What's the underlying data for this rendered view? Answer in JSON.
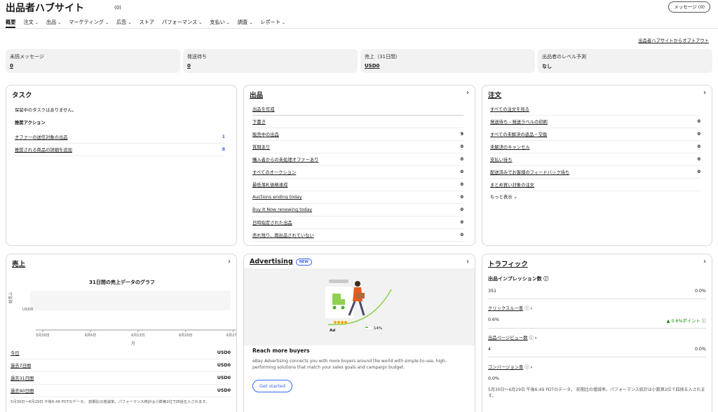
{
  "header": {
    "title": "出品者ハブサイト",
    "count": "(0)",
    "message_button": "メッセージ (0)"
  },
  "nav": {
    "items": [
      {
        "label": "概要",
        "has_menu": false
      },
      {
        "label": "注文",
        "has_menu": true
      },
      {
        "label": "出品",
        "has_menu": true
      },
      {
        "label": "マーケティング",
        "has_menu": true
      },
      {
        "label": "広告",
        "has_menu": true
      },
      {
        "label": "ストア",
        "has_menu": false
      },
      {
        "label": "パフォーマンス",
        "has_menu": true
      },
      {
        "label": "支払い",
        "has_menu": true
      },
      {
        "label": "調査",
        "has_menu": true
      },
      {
        "label": "レポート",
        "has_menu": true
      }
    ],
    "chevron": "⌄"
  },
  "optout": "出品者ハブサイトからオプトアウト",
  "stats": [
    {
      "label": "未読メッセージ",
      "value": "0",
      "link": true
    },
    {
      "label": "発送待ち",
      "value": "0",
      "link": true
    },
    {
      "label": "売上（31日間）",
      "value": "USD0",
      "link": true
    },
    {
      "label": "出品者のレベル予測",
      "value": "なし",
      "link": false
    }
  ],
  "tasks": {
    "title": "タスク",
    "empty": "保留中のタスクはありません。",
    "recommended": "推奨アクション",
    "rows": [
      {
        "label": "オファーの送信対象の出品",
        "value": "1"
      },
      {
        "label": "推奨される商品の詳細を追加",
        "value": "8"
      }
    ]
  },
  "listings": {
    "title": "出品",
    "arrow": "›",
    "top_link": "出品を作成",
    "rows": [
      {
        "label": "下書き",
        "value": ""
      },
      {
        "label": "販売中の出品",
        "value": "9"
      },
      {
        "label": "質問あり",
        "value": "0"
      },
      {
        "label": "購入者からの未処理オファーあり",
        "value": "0"
      },
      {
        "label": "すべてのオークション",
        "value": "0"
      },
      {
        "label": "最低落札価格達成",
        "value": "0"
      },
      {
        "label": "Auctions ending today",
        "value": "0"
      },
      {
        "label": "Buy It Now renewing today",
        "value": "0"
      },
      {
        "label": "日時指定された出品",
        "value": "0"
      },
      {
        "label": "売れ残り、再出品されていない",
        "value": "0"
      }
    ]
  },
  "orders": {
    "title": "注文",
    "arrow": "›",
    "rows": [
      {
        "label": "すべての注文を見る",
        "value": ""
      },
      {
        "label": "発送待ち - 発送ラベルの印刷",
        "value": "0"
      },
      {
        "label": "すべての未解決の返品・交換",
        "value": "0"
      },
      {
        "label": "未解決のキャンセル",
        "value": "0"
      },
      {
        "label": "支払い待ち",
        "value": "0"
      },
      {
        "label": "配送済みでお客様のフィードバック待ち",
        "value": "0"
      },
      {
        "label": "まとめ買い対象の注文",
        "value": ""
      }
    ],
    "more": "もっと表示",
    "more_icon": "⌄"
  },
  "sales": {
    "title": "売上",
    "arrow": "›",
    "chart_title": "31日間の売上データのグラフ",
    "ylabel": "総売上",
    "xlabel": "月",
    "rows": [
      {
        "label": "今日",
        "value": "USD0"
      },
      {
        "label": "過去7日間",
        "value": "USD0"
      },
      {
        "label": "過去31日間",
        "value": "USD0"
      },
      {
        "label": "過去90日間",
        "value": "USD0"
      }
    ],
    "footnote": "5月30日〜6月29日 午後6:49 PDTのデータ。 前期比の増減率。パフォーマンス統計は小数第2位で四捨五入されます。"
  },
  "chart_data": {
    "type": "line",
    "title": "31日間の売上データのグラフ",
    "xlabel": "月",
    "ylabel": "総売上",
    "x": [
      "5月30日",
      "6月6日",
      "6月13日",
      "6月20日",
      "6月27日"
    ],
    "series": [
      {
        "values": [
          0,
          0,
          0,
          0,
          0
        ]
      }
    ],
    "y_tick_labels": [
      "USD0"
    ],
    "grid": false
  },
  "advertising": {
    "title": "Advertising",
    "badge": "NEW",
    "arrow": "›",
    "ad_label": "Ad",
    "percent": "14%",
    "heading": "Reach more buyers",
    "body": "eBay Advertising connects you with more buyers around the world with simple-to-use, high-performing solutions that match your sales goals and campaign budget.",
    "cta": "Get started"
  },
  "traffic": {
    "title": "トラフィック",
    "arrow": "›",
    "impressions_label": "出品インプレッション数",
    "impressions": "351",
    "impressions_change": "0.0%",
    "ctr_label": "クリックスルー率",
    "ctr": "0.6%",
    "ctr_change": "▲ 0.6%ポイント",
    "views_label": "出品ページビュー数",
    "views": "4",
    "views_change": "0.0%",
    "conversion_label": "コンバージョン率",
    "conversion": "0.0%",
    "info_icon": "ⓘ",
    "link_chevron": "›",
    "footnote": "5月30日〜6月29日 午後6:49 PDTのデータ。 前期比の増減率。パフォーマンス統計は小数第2位で四捨五入されます。"
  },
  "colors": {
    "accent": "#3665f3",
    "green": "#118a00",
    "stat_bg": "#f2f2f2"
  }
}
